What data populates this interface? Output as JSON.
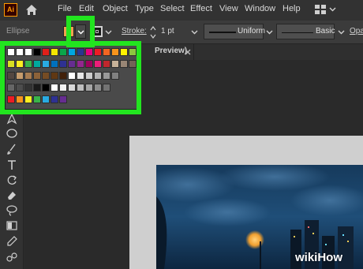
{
  "menubar": {
    "logo": "Ai",
    "menus": [
      "File",
      "Edit",
      "Object",
      "Type",
      "Select",
      "Effect",
      "View",
      "Window",
      "Help"
    ]
  },
  "controlbar": {
    "selection_label": "Ellipse",
    "stroke_label": "Stroke:",
    "stroke_weight": "1 pt",
    "variable_width_profile": "Uniform",
    "brush_definition": "Basic",
    "opacity_label": "Opacity"
  },
  "document": {
    "tab_label": "Preview)"
  },
  "colors": {
    "highlight": "#22e51f",
    "accent_logo": "#ff9a00",
    "fill_color": "#f0a050"
  },
  "swatches": {
    "rows": [
      [
        "#ffffff",
        "#ffffff",
        "#ffffff",
        "#000000",
        "#e0201a",
        "#f5e600",
        "#0aa64a",
        "#00a6e0",
        "#2a3590",
        "#e6007e",
        "#ed1c24",
        "#f26522",
        "#f7941d",
        "#fff200",
        "#8dc63f"
      ],
      [
        "#d7df23",
        "#fcee21",
        "#39b54a",
        "#00a99d",
        "#29abe2",
        "#0071bc",
        "#2e3192",
        "#662d91",
        "#93278f",
        "#9e005d",
        "#ed1e79",
        "#c1272d",
        "#c7b299",
        "#998675",
        "#736357"
      ],
      [
        "#534741",
        "#c69c6d",
        "#a67c52",
        "#8c6239",
        "#754c24",
        "#603813",
        "#42210b",
        "#ffffff",
        "#e6e6e6",
        "#cccccc",
        "#b3b3b3",
        "#999999",
        "#808080"
      ],
      [
        "#666666",
        "#4d4d4d",
        "#333333",
        "#1a1a1a",
        "#000000",
        "#ffffff",
        "#f2f2f2",
        "#d9d9d9",
        "#bfbfbf",
        "#a6a6a6",
        "#8c8c8c",
        "#737373"
      ],
      [
        "#ed1c24",
        "#f7931e",
        "#fcee21",
        "#39b54a",
        "#29abe2",
        "#2e3192",
        "#662d91"
      ]
    ]
  },
  "watermark": "wikiHow"
}
